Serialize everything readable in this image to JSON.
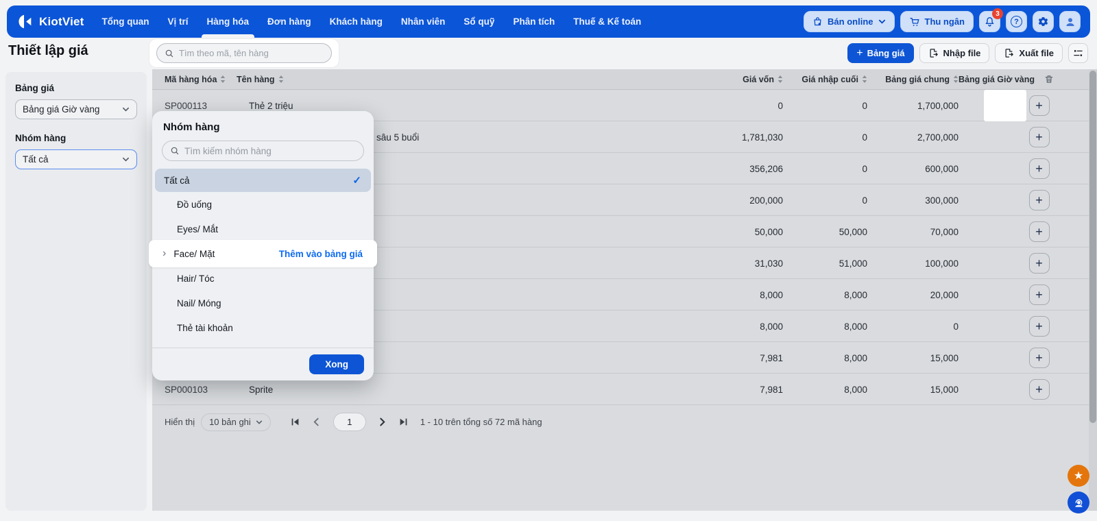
{
  "nav": {
    "brand": "KiotViet",
    "items": [
      {
        "label": "Tổng quan",
        "active": false
      },
      {
        "label": "Vị trí",
        "active": false
      },
      {
        "label": "Hàng hóa",
        "active": true
      },
      {
        "label": "Đơn hàng",
        "active": false
      },
      {
        "label": "Khách hàng",
        "active": false
      },
      {
        "label": "Nhân viên",
        "active": false
      },
      {
        "label": "Sổ quỹ",
        "active": false
      },
      {
        "label": "Phân tích",
        "active": false
      },
      {
        "label": "Thuế & Kế toán",
        "active": false
      }
    ],
    "ban_online_label": "Bán online",
    "thu_ngan_label": "Thu ngân",
    "notification_badge": "3",
    "help_glyph": "?"
  },
  "page": {
    "title": "Thiết lập giá"
  },
  "toolbar": {
    "search_placeholder": "Tìm theo mã, tên hàng",
    "add_button": "Bảng giá",
    "import_button": "Nhập file",
    "export_button": "Xuất file"
  },
  "sidebar": {
    "price_book_label": "Bảng giá",
    "price_book_value": "Bảng giá Giờ vàng",
    "group_label": "Nhóm hàng",
    "group_value": "Tất cả"
  },
  "table": {
    "columns": [
      "Mã hàng hóa",
      "Tên hàng",
      "Giá vốn",
      "Giá nhập cuối",
      "Bảng giá chung",
      "Bảng giá Giờ vàng"
    ],
    "rows": [
      {
        "code": "SP000113",
        "name": "Thẻ 2 triệu",
        "cost": "0",
        "last_purchase": "0",
        "base_price": "1,700,000",
        "plus_highlight": true,
        "name_clipped": false
      },
      {
        "code": "",
        "name": "sâu 5 buổi",
        "cost": "1,781,030",
        "last_purchase": "0",
        "base_price": "2,700,000",
        "plus_highlight": false,
        "name_clipped": true
      },
      {
        "code": "",
        "name": "",
        "cost": "356,206",
        "last_purchase": "0",
        "base_price": "600,000",
        "plus_highlight": false,
        "name_clipped": false
      },
      {
        "code": "",
        "name": "",
        "cost": "200,000",
        "last_purchase": "0",
        "base_price": "300,000",
        "plus_highlight": false,
        "name_clipped": false
      },
      {
        "code": "",
        "name": "",
        "cost": "50,000",
        "last_purchase": "50,000",
        "base_price": "70,000",
        "plus_highlight": false,
        "name_clipped": false
      },
      {
        "code": "",
        "name": "",
        "cost": "31,030",
        "last_purchase": "51,000",
        "base_price": "100,000",
        "plus_highlight": false,
        "name_clipped": false
      },
      {
        "code": "",
        "name": "",
        "cost": "8,000",
        "last_purchase": "8,000",
        "base_price": "20,000",
        "plus_highlight": false,
        "name_clipped": false
      },
      {
        "code": "",
        "name": "",
        "cost": "8,000",
        "last_purchase": "8,000",
        "base_price": "0",
        "plus_highlight": false,
        "name_clipped": false
      },
      {
        "code": "",
        "name": "",
        "cost": "7,981",
        "last_purchase": "8,000",
        "base_price": "15,000",
        "plus_highlight": false,
        "name_clipped": false
      },
      {
        "code": "SP000103",
        "name": "Sprite",
        "cost": "7,981",
        "last_purchase": "8,000",
        "base_price": "15,000",
        "plus_highlight": false,
        "name_clipped": false
      }
    ]
  },
  "group_panel": {
    "title": "Nhóm hàng",
    "search_placeholder": "Tìm kiếm nhóm hàng",
    "items": [
      {
        "label": "Tất cả",
        "selected": true,
        "child": false,
        "highlighted": false,
        "action": ""
      },
      {
        "label": "Đồ uống",
        "selected": false,
        "child": true,
        "highlighted": false,
        "action": ""
      },
      {
        "label": "Eyes/ Mắt",
        "selected": false,
        "child": true,
        "highlighted": false,
        "action": ""
      },
      {
        "label": "Face/ Mặt",
        "selected": false,
        "child": true,
        "highlighted": true,
        "action": "Thêm vào bảng giá"
      },
      {
        "label": "Hair/ Tóc",
        "selected": false,
        "child": true,
        "highlighted": false,
        "action": ""
      },
      {
        "label": "Nail/ Móng",
        "selected": false,
        "child": true,
        "highlighted": false,
        "action": ""
      },
      {
        "label": "Thẻ tài khoản",
        "selected": false,
        "child": true,
        "highlighted": false,
        "action": ""
      }
    ],
    "done_button": "Xong"
  },
  "pagination": {
    "show_label": "Hiển thị",
    "page_size": "10 bản ghi",
    "current_page": "1",
    "summary": "1 - 10 trên tổng số 72 mã hàng"
  },
  "colors": {
    "brand_blue": "#0b55d8",
    "accent_orange": "#e4750c",
    "badge_red": "#e8432f",
    "link_blue": "#0d6bf0"
  }
}
